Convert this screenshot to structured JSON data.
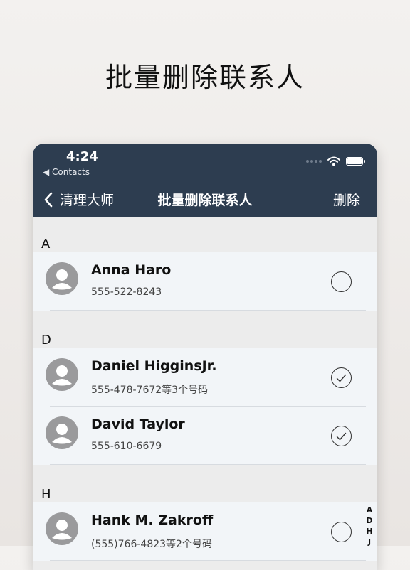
{
  "promo": {
    "title": "批量删除联系人"
  },
  "status_bar": {
    "time": "4:24",
    "back_label": "◀ Contacts"
  },
  "nav": {
    "back_label": "清理大师",
    "title": "批量删除联系人",
    "action_label": "删除"
  },
  "sections": [
    {
      "letter": "A",
      "contacts": [
        {
          "name": "Anna Haro",
          "phone": "555-522-8243",
          "selected": false
        }
      ]
    },
    {
      "letter": "D",
      "contacts": [
        {
          "name": "Daniel HigginsJr.",
          "phone": "555-478-7672等3个号码",
          "selected": true
        },
        {
          "name": "David Taylor",
          "phone": "555-610-6679",
          "selected": true
        }
      ]
    },
    {
      "letter": "H",
      "contacts": [
        {
          "name": "Hank M. Zakroff",
          "phone": "(555)766-4823等2个号码",
          "selected": false
        }
      ]
    }
  ],
  "index_letters": [
    "A",
    "D",
    "H",
    "J"
  ],
  "colors": {
    "nav_background": "#2d3d50",
    "row_background": "#f2f5f8",
    "section_background": "#ececec",
    "avatar": "#9a9a9c"
  },
  "icons": {
    "back": "chevron-left-icon",
    "wifi": "wifi-icon",
    "battery": "battery-icon",
    "avatar": "person-icon",
    "checkbox_checked": "checkmark-icon",
    "checkbox_empty": "empty-circle-icon"
  }
}
